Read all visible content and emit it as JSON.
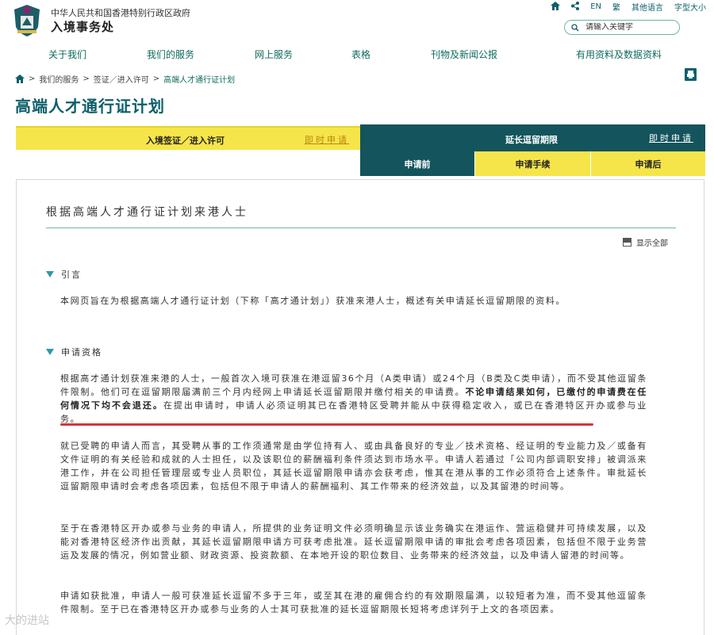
{
  "header": {
    "gov_title": "中华人民共和国香港特别行政区政府",
    "dept_title": "入境事务处",
    "top_links": {
      "lang_en": "EN",
      "lang_trad": "繁",
      "other_lang": "其他语言",
      "font_size": "字型大小"
    },
    "search_placeholder": "请输入关键字"
  },
  "nav": [
    "关于我们",
    "我们的服务",
    "网上服务",
    "表格",
    "刊物及新闻公报",
    "有用资料及数据资料"
  ],
  "breadcrumb": [
    "我们的服务",
    "签证／进入许可",
    "高端人才通行证计划"
  ],
  "page_title": "高端人才通行证计划",
  "tabs": {
    "left_label": "入境签证／进入许可",
    "left_apply": "即时申请",
    "right_label": "延长逗留期限",
    "right_apply": "即时申请",
    "sub": [
      "申请前",
      "申请手续",
      "申请后"
    ]
  },
  "content": {
    "section_heading": "根据高端人才通行证计划来港人士",
    "show_all": "显示全部",
    "intro_title": "引言",
    "intro_text": "本网页旨在为根据高端人才通行证计划（下称「高才通计划」）获准来港人士，概述有关申请延长逗留期限的资料。",
    "elig_title": "申请资格",
    "elig_p1_a": "根据高才通计划获准来港的人士，一般首次入境可获准在港逗留36个月（A类申请）或24个月（B类及C类申请），而不受其他逗留条件限制。他们可在逗留期限届满前三个月内经网上申请延长逗留期限并缴付相关的申请费。",
    "elig_p1_b": "不论申请结果如何，已缴付的申请费在任何情况下均不会退还。",
    "elig_p1_c": "在提出申请时，申请人必须证明其已在香港特区受聘并能从中获得稳定收入，或已在香港特区开办或参与业务。",
    "elig_p2": "就已受聘的申请人而言，其受聘从事的工作须通常是由学位持有人、或由具备良好的专业／技术资格、经证明的专业能力及／或备有文件证明的有关经验和成就的人士担任，以及该职位的薪酬福利条件须达到市场水平。申请人若通过「公司内部调职安排」被调派来港工作，并在公司担任管理层或专业人员职位，其延长逗留期限申请亦会获考虑，惟其在港从事的工作必须符合上述条件。审批延长逗留期限申请时会考虑各项因素，包括但不限于申请人的薪酬福利、其工作带来的经济效益，以及其留港的时间等。",
    "elig_p3": "至于在香港特区开办或参与业务的申请人，所提供的业务证明文件必须明确显示该业务确实在港运作、营运稳健并可持续发展，以及能对香港特区经济作出贡献，其延长逗留期限申请方可获考虑批准。延长逗留期限申请的审批会考虑各项因素，包括但不限于业务营运及发展的情况，例如营业额、财政资源、投资款额、在本地开设的职位数目、业务带来的经济效益，以及申请人留港的时间等。",
    "elig_p4": "申请如获批准，申请人一般可获准延长逗留不多于三年，或至其在港的雇佣合约的有效期限届满，以较短者为准，而不受其他逗留条件限制。至于已在香港特区开办或参与业务的人士其可获批准的延长逗留期限长短将考虑详列于上文的各项因素。"
  },
  "watermark": "大的进站"
}
